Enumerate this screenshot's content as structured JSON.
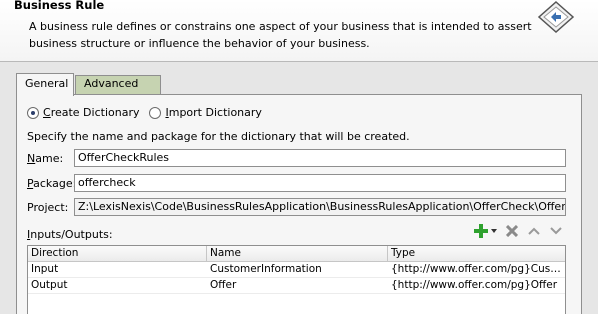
{
  "header": {
    "title": "Business Rule",
    "description": "A business rule defines or constrains one aspect of your business that is intended to assert business structure or influence the behavior of your business."
  },
  "tabs": [
    {
      "label": "General",
      "selected": true
    },
    {
      "label": "Advanced",
      "selected": false
    }
  ],
  "options": {
    "create_dictionary": {
      "prefix": "",
      "accel": "C",
      "rest": "reate Dictionary",
      "checked": true
    },
    "import_dictionary": {
      "prefix": "",
      "accel": "I",
      "rest": "mport Dictionary",
      "checked": false
    }
  },
  "instruction": "Specify the name and package for the dictionary that will be created.",
  "fields": {
    "name": {
      "accel": "N",
      "rest": "ame:",
      "value": "OfferCheckRules"
    },
    "package": {
      "accel": "P",
      "rest": "ackage:",
      "value": "offercheck"
    },
    "project": {
      "label": "Project:",
      "value": "Z:\\LexisNexis\\Code\\BusinessRulesApplication\\BusinessRulesApplication\\OfferCheck\\OfferCheck.jpr"
    }
  },
  "io": {
    "label_accel": "I",
    "label_rest": "nputs/Outputs:",
    "columns": [
      "Direction",
      "Name",
      "Type"
    ],
    "rows": [
      [
        "Input",
        "CustomerInformation",
        "{http://www.offer.com/pg}Custo..."
      ],
      [
        "Output",
        "Offer",
        "{http://www.offer.com/pg}Offer"
      ]
    ]
  },
  "colors": {
    "advanced_tab": "#c6d3b1",
    "add_icon": "#2ea12e"
  }
}
